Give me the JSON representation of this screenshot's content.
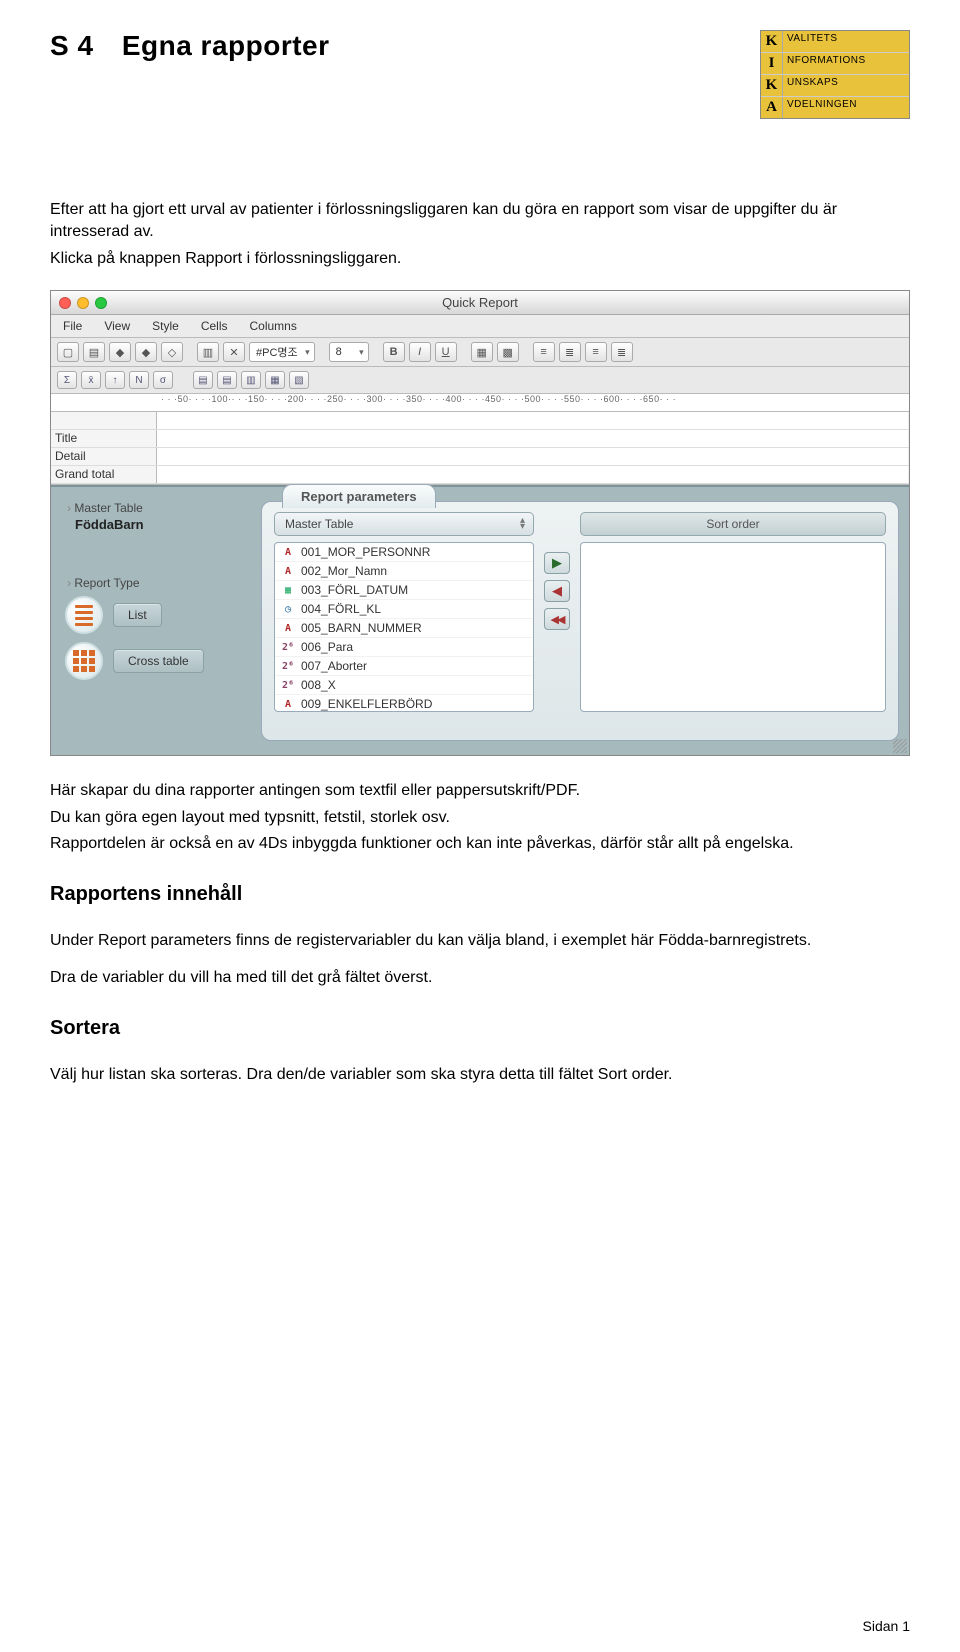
{
  "header": {
    "section_number": "S 4",
    "title": "Egna rapporter"
  },
  "logo": {
    "rows": [
      {
        "letter": "K",
        "word": "VALITETS"
      },
      {
        "letter": "I",
        "word": "NFORMATIONS"
      },
      {
        "letter": "K",
        "word": "UNSKAPS"
      },
      {
        "letter": "A",
        "word": "VDELNINGEN"
      }
    ]
  },
  "intro": {
    "p1": "Efter att ha gjort ett urval av patienter i förlossningsliggaren kan du göra en rapport som visar de uppgifter du är intresserad av.",
    "p2": "Klicka på knappen Rapport i förlossningsliggaren."
  },
  "qr": {
    "window_title": "Quick Report",
    "menus": [
      "File",
      "View",
      "Style",
      "Cells",
      "Columns"
    ],
    "font_family_selected": "#PC명조",
    "font_size_selected": "8",
    "ruler_text": "· · ·50· · · ·100·· · ·150· · · ·200· · · ·250· · · ·300· · · ·350· · · ·400· · · ·450· · · ·500· · · ·550· · · ·600· · · ·650· · ·",
    "row_labels": [
      "Title",
      "Detail",
      "Grand total"
    ],
    "side": {
      "master_label": "Master Table",
      "master_value": "FöddaBarn",
      "report_type_label": "Report Type",
      "list_label": "List",
      "cross_label": "Cross table"
    },
    "params": {
      "tab_label": "Report parameters",
      "master_combo": "Master Table",
      "sort_header": "Sort order",
      "fields": [
        {
          "icon": "a",
          "name": "001_MOR_PERSONNR"
        },
        {
          "icon": "a",
          "name": "002_Mor_Namn"
        },
        {
          "icon": "d",
          "name": "003_FÖRL_DATUM"
        },
        {
          "icon": "t",
          "name": "004_FÖRL_KL"
        },
        {
          "icon": "a",
          "name": "005_BARN_NUMMER"
        },
        {
          "icon": "n",
          "name": "006_Para"
        },
        {
          "icon": "n",
          "name": "007_Aborter"
        },
        {
          "icon": "n",
          "name": "008_X"
        },
        {
          "icon": "a",
          "name": "009_ENKELFLERBÖRD"
        }
      ]
    }
  },
  "after": {
    "p1": "Här skapar du dina rapporter antingen som textfil eller pappersutskrift/PDF.",
    "p2": "Du kan göra egen layout med typsnitt, fetstil, storlek osv.",
    "p3": "Rapportdelen är också en av 4Ds inbyggda funktioner och kan inte påverkas, därför står allt på engelska."
  },
  "sec1": {
    "title": "Rapportens innehåll",
    "p1": "Under Report parameters finns de registervariabler du kan välja bland, i exemplet här Födda-barnregistrets.",
    "p2": "Dra de variabler du vill ha med till det grå fältet överst."
  },
  "sec2": {
    "title": "Sortera",
    "p1": "Välj hur listan ska sorteras. Dra den/de variabler som ska styra detta till fältet Sort order."
  },
  "footer": "Sidan 1"
}
